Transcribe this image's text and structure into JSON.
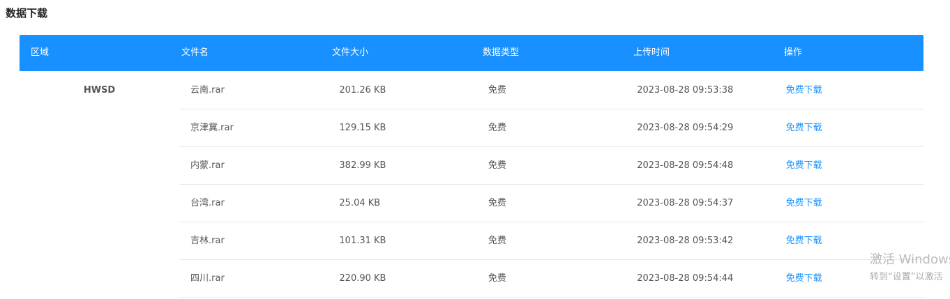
{
  "title": "数据下载",
  "headers": [
    "区域",
    "文件名",
    "文件大小",
    "数据类型",
    "上传时间",
    "操作"
  ],
  "region": "HWSD",
  "rows": [
    {
      "name": "云南.rar",
      "size": "201.26 KB",
      "type": "免费",
      "time": "2023-08-28 09:53:38",
      "action": "免费下载"
    },
    {
      "name": "京津冀.rar",
      "size": "129.15 KB",
      "type": "免费",
      "time": "2023-08-28 09:54:29",
      "action": "免费下载"
    },
    {
      "name": "内蒙.rar",
      "size": "382.99 KB",
      "type": "免费",
      "time": "2023-08-28 09:54:48",
      "action": "免费下载"
    },
    {
      "name": "台湾.rar",
      "size": "25.04 KB",
      "type": "免费",
      "time": "2023-08-28 09:54:37",
      "action": "免费下载"
    },
    {
      "name": "吉林.rar",
      "size": "101.31 KB",
      "type": "免费",
      "time": "2023-08-28 09:53:42",
      "action": "免费下载"
    },
    {
      "name": "四川.rar",
      "size": "220.90 KB",
      "type": "免费",
      "time": "2023-08-28 09:54:44",
      "action": "免费下载"
    }
  ],
  "watermark": {
    "line1": "激活 Windows",
    "line2": "转到“设置”以激活"
  }
}
